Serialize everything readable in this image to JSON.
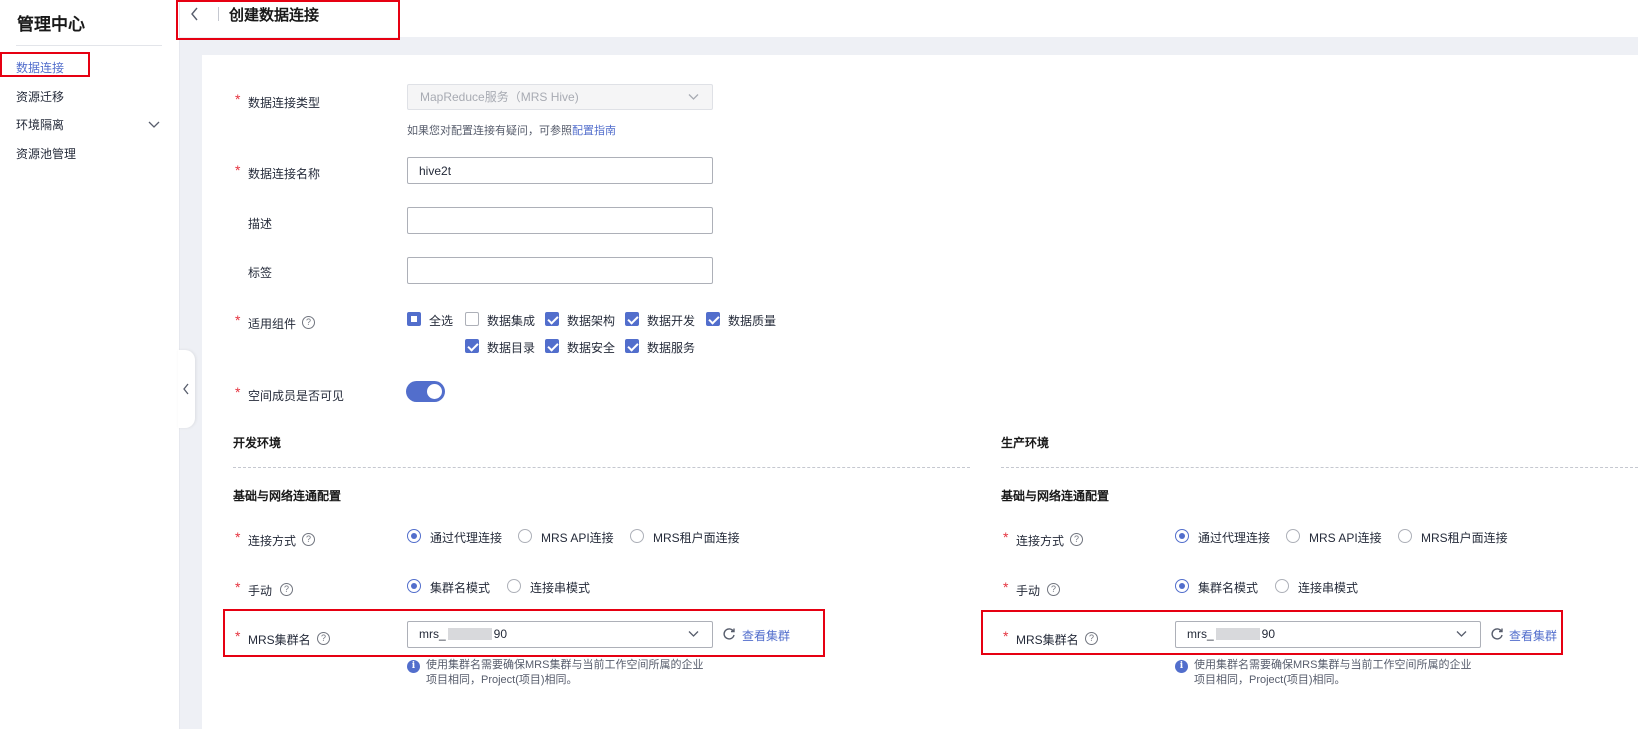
{
  "sidebar": {
    "title": "管理中心",
    "items": [
      {
        "label": "数据连接",
        "active": true
      },
      {
        "label": "资源迁移"
      },
      {
        "label": "环境隔离",
        "has_submenu": true
      },
      {
        "label": "资源池管理"
      }
    ]
  },
  "header": {
    "title": "创建数据连接"
  },
  "form": {
    "type": {
      "label": "数据连接类型",
      "value": "MapReduce服务（MRS Hive)",
      "hint_text": "如果您对配置连接有疑问，可参照",
      "hint_link": "配置指南"
    },
    "name": {
      "label": "数据连接名称",
      "value": "hive2t"
    },
    "description": {
      "label": "描述",
      "value": ""
    },
    "tags": {
      "label": "标签",
      "value": ""
    },
    "components": {
      "label": "适用组件",
      "options": [
        {
          "label": "全选",
          "state": "partial"
        },
        {
          "label": "数据集成",
          "state": "unchecked"
        },
        {
          "label": "数据架构",
          "state": "checked"
        },
        {
          "label": "数据开发",
          "state": "checked"
        },
        {
          "label": "数据质量",
          "state": "checked"
        },
        {
          "label": "数据目录",
          "state": "checked"
        },
        {
          "label": "数据安全",
          "state": "checked"
        },
        {
          "label": "数据服务",
          "state": "checked"
        }
      ]
    },
    "visible": {
      "label": "空间成员是否可见",
      "on": true
    }
  },
  "envs": [
    {
      "title": "开发环境",
      "section": "基础与网络连通配置",
      "connect": {
        "label": "连接方式",
        "options": [
          "通过代理连接",
          "MRS API连接",
          "MRS租户面连接"
        ],
        "selected": 0
      },
      "manual": {
        "label": "手动",
        "options": [
          "集群名模式",
          "连接串模式"
        ],
        "selected": 0
      },
      "cluster": {
        "label": "MRS集群名",
        "prefix": "mrs_",
        "suffix": "90",
        "view_link": "查看集群"
      },
      "note_line1": "使用集群名需要确保MRS集群与当前工作空间所属的企业",
      "note_line2": "项目相同，Project(项目)相同。"
    },
    {
      "title": "生产环境",
      "section": "基础与网络连通配置",
      "connect": {
        "label": "连接方式",
        "options": [
          "通过代理连接",
          "MRS API连接",
          "MRS租户面连接"
        ],
        "selected": 0
      },
      "manual": {
        "label": "手动",
        "options": [
          "集群名模式",
          "连接串模式"
        ],
        "selected": 0
      },
      "cluster": {
        "label": "MRS集群名",
        "prefix": "mrs_",
        "suffix": "90",
        "view_link": "查看集群"
      },
      "note_line1": "使用集群名需要确保MRS集群与当前工作空间所属的企业",
      "note_line2": "项目相同，Project(项目)相同。"
    }
  ],
  "colors": {
    "accent": "#526ecc",
    "required": "#e5323e",
    "highlight_box": "#e60012"
  }
}
